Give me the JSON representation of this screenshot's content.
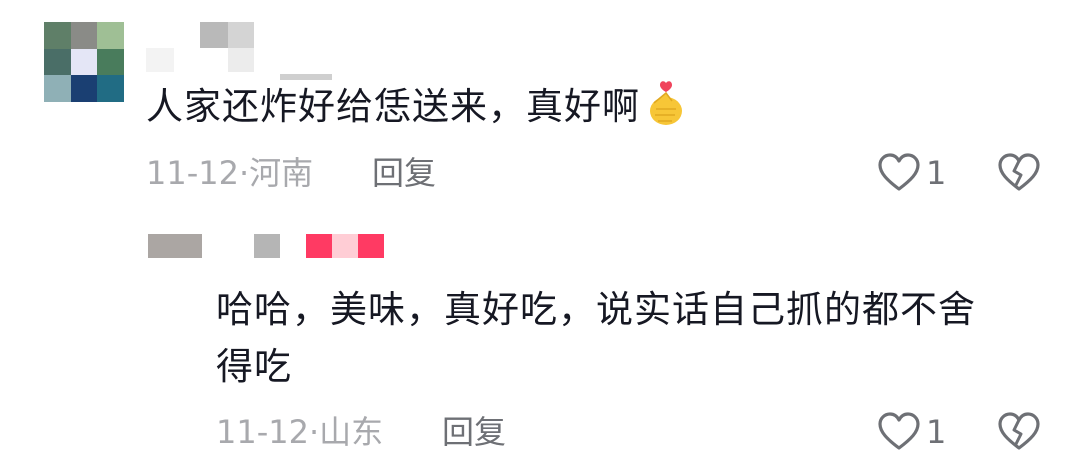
{
  "comments": [
    {
      "text": "人家还炸好给恁送来，真好啊",
      "emoji": "🫰",
      "date": "11-12",
      "separator": "·",
      "location": "河南",
      "reply_label": "回复",
      "likes": "1"
    }
  ],
  "replies": [
    {
      "text_line1": "哈哈，美味，真好吃，说实话自己抓的都不舍",
      "text_line2": "得吃",
      "date": "11-12",
      "separator": "·",
      "location": "山东",
      "reply_label": "回复",
      "likes": "1"
    }
  ],
  "icons": {
    "like": "heart-outline-icon",
    "dislike": "broken-heart-icon",
    "emoji": "finger-heart-emoji-icon"
  },
  "colors": {
    "text": "#161823",
    "meta": "#a8a9ad",
    "action": "#6e7075",
    "username_badge": "#fe2c55"
  }
}
